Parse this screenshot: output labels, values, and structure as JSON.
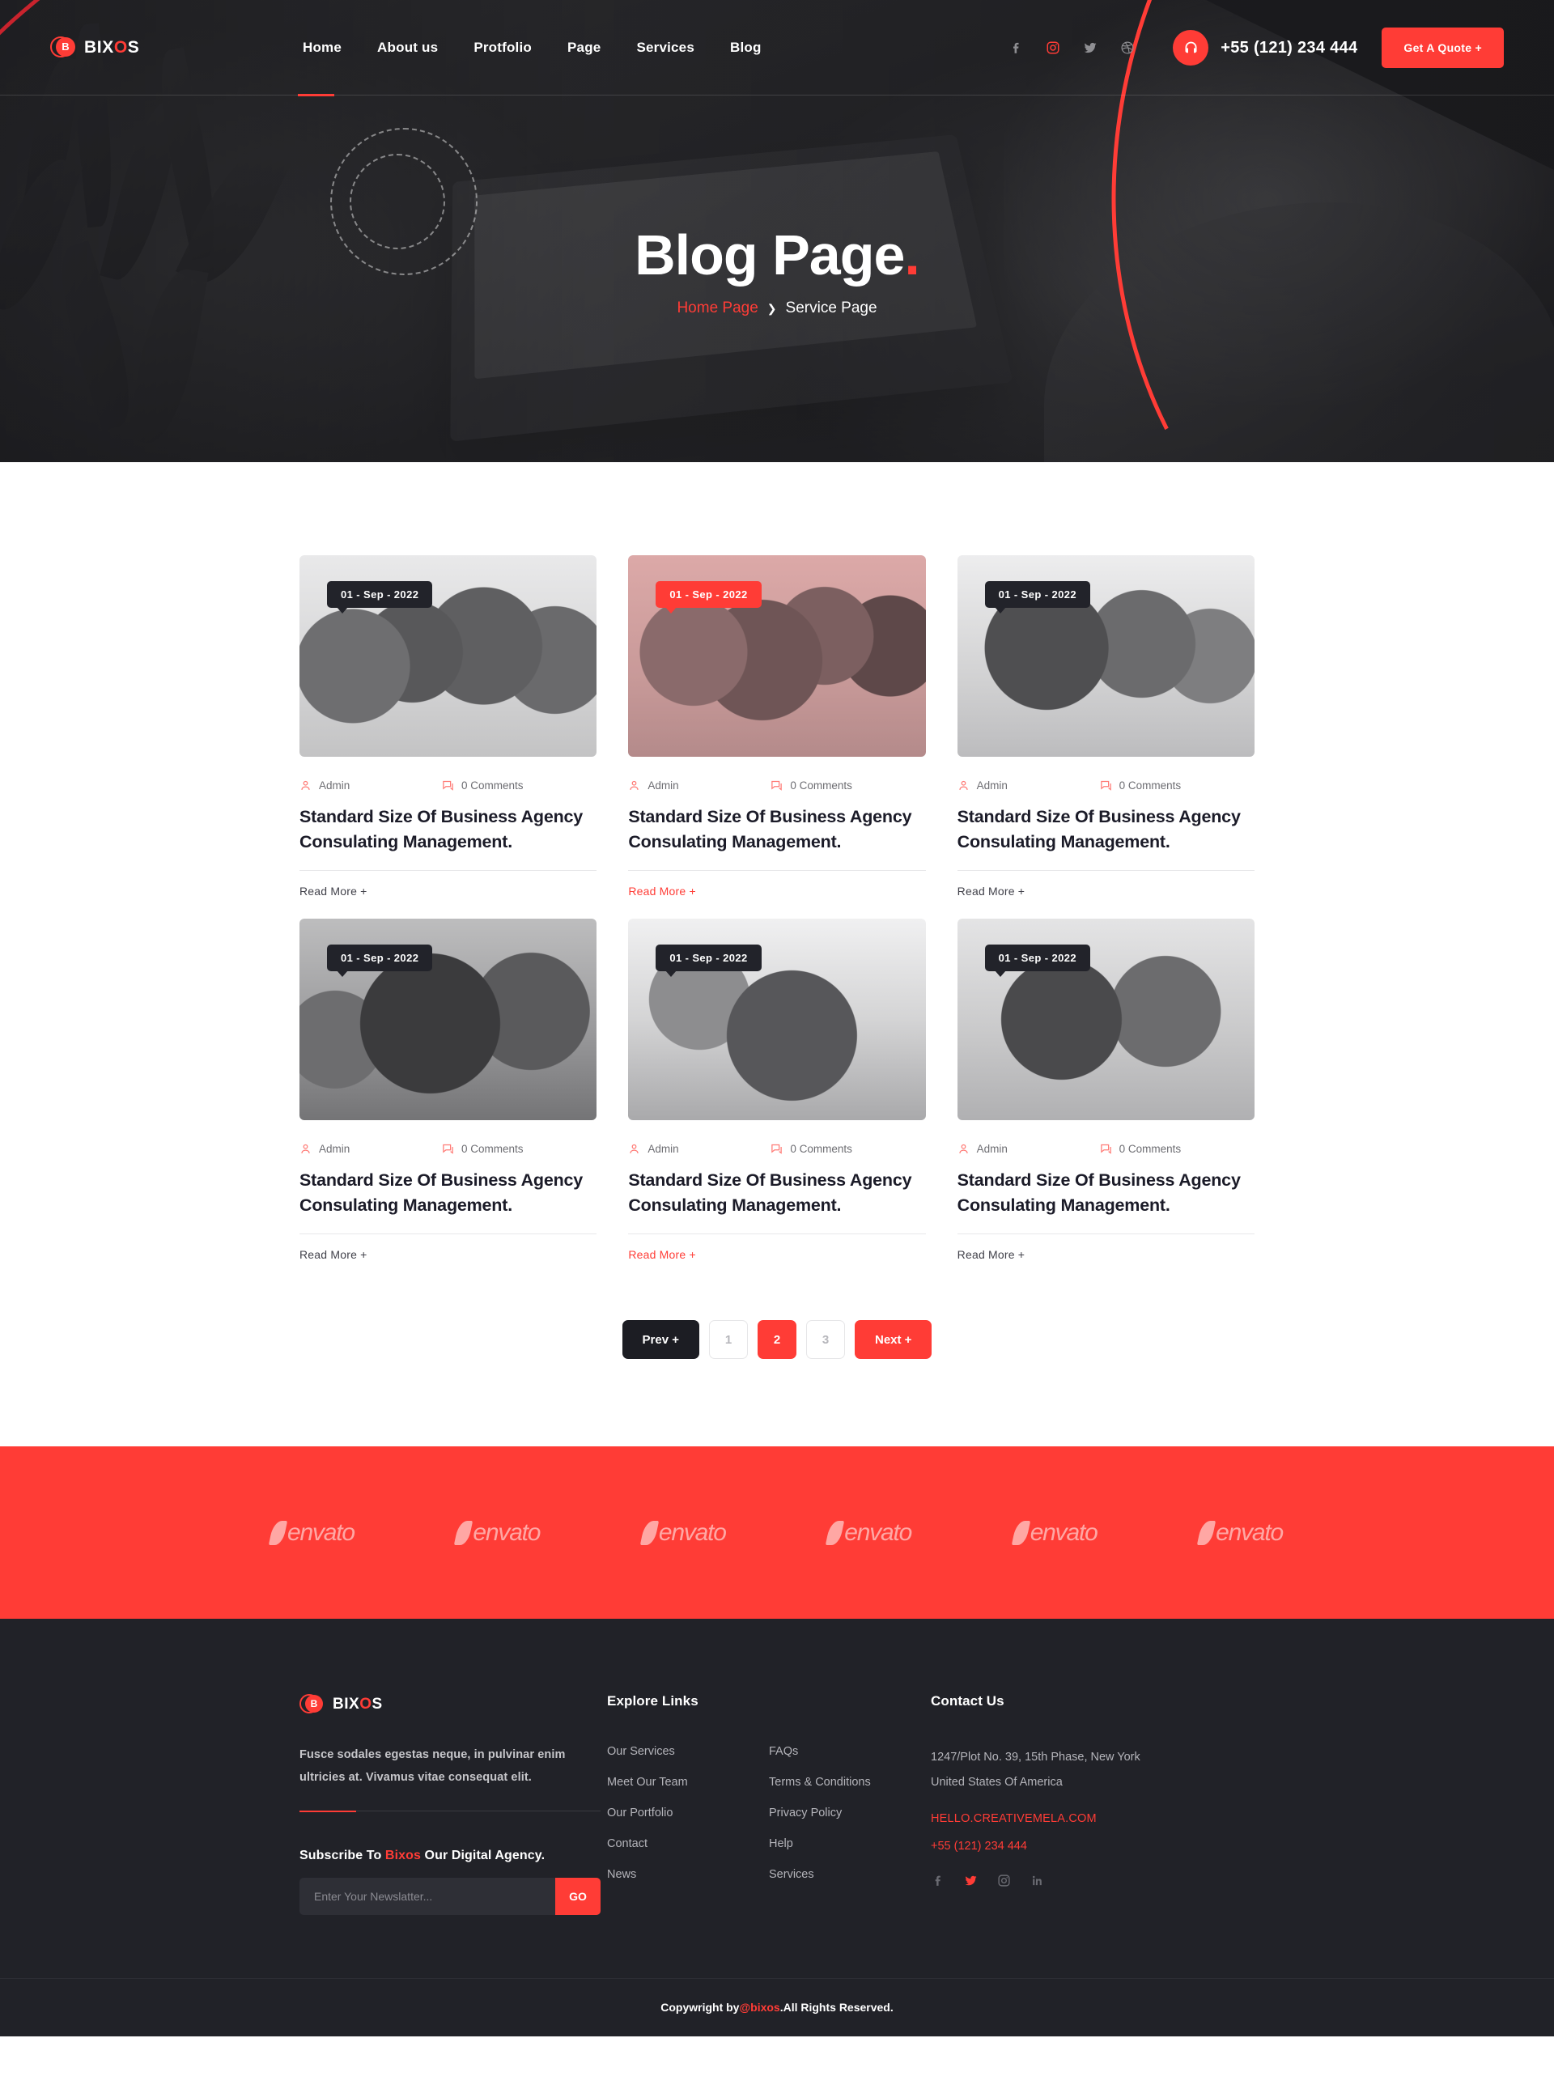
{
  "colors": {
    "accent": "#ff3c36",
    "dark": "#212228",
    "badge_dark": "#22232a",
    "heading": "#1b1b28"
  },
  "header": {
    "logo": {
      "mark_letter": "B",
      "text_pre": "BIX",
      "text_accent": "O",
      "text_post": "S"
    },
    "nav": [
      {
        "label": "Home",
        "active": true
      },
      {
        "label": "About us",
        "active": false
      },
      {
        "label": "Protfolio",
        "active": false
      },
      {
        "label": "Page",
        "active": false
      },
      {
        "label": "Services",
        "active": false
      },
      {
        "label": "Blog",
        "active": false
      }
    ],
    "socials": [
      {
        "name": "facebook-icon",
        "active": false
      },
      {
        "name": "instagram-icon",
        "active": true
      },
      {
        "name": "twitter-icon",
        "active": false
      },
      {
        "name": "dribbble-icon",
        "active": false
      }
    ],
    "phone": "+55 (121) 234 444",
    "quote_button": "Get A Quote +"
  },
  "hero": {
    "title": "Blog Page",
    "title_dot": ".",
    "breadcrumb": {
      "home": "Home Page",
      "separator": "❯",
      "current": "Service Page"
    }
  },
  "blog": {
    "posts": [
      {
        "date": "01 - Sep - 2022",
        "author": "Admin",
        "comments": "0 Comments",
        "title": "Standard Size Of Business Agency Consulating Management.",
        "read_more": "Read More +",
        "highlighted": false,
        "photo": "ph-a"
      },
      {
        "date": "01 - Sep - 2022",
        "author": "Admin",
        "comments": "0 Comments",
        "title": "Standard Size Of Business Agency Consulating Management.",
        "read_more": "Read More +",
        "highlighted": true,
        "photo": "ph-b"
      },
      {
        "date": "01 - Sep - 2022",
        "author": "Admin",
        "comments": "0 Comments",
        "title": "Standard Size Of Business Agency Consulating Management.",
        "read_more": "Read More +",
        "highlighted": false,
        "photo": "ph-c"
      },
      {
        "date": "01 - Sep - 2022",
        "author": "Admin",
        "comments": "0 Comments",
        "title": "Standard Size Of Business Agency Consulating Management.",
        "read_more": "Read More +",
        "highlighted": false,
        "photo": "ph-d"
      },
      {
        "date": "01 - Sep - 2022",
        "author": "Admin",
        "comments": "0 Comments",
        "title": "Standard Size Of Business Agency Consulating Management.",
        "read_more": "Read More +",
        "highlighted": true,
        "photo": "ph-e"
      },
      {
        "date": "01 - Sep - 2022",
        "author": "Admin",
        "comments": "0 Comments",
        "title": "Standard Size Of Business Agency Consulating Management.",
        "read_more": "Read More +",
        "highlighted": false,
        "photo": "ph-f"
      }
    ],
    "pagination": {
      "prev": "Prev +",
      "pages": [
        {
          "label": "1",
          "active": false
        },
        {
          "label": "2",
          "active": true
        },
        {
          "label": "3",
          "active": false
        }
      ],
      "next": "Next +"
    }
  },
  "brands": {
    "items": [
      {
        "name": "envato"
      },
      {
        "name": "envato"
      },
      {
        "name": "envato"
      },
      {
        "name": "envato"
      },
      {
        "name": "envato"
      },
      {
        "name": "envato"
      }
    ]
  },
  "footer": {
    "logo": {
      "mark_letter": "B",
      "text_pre": "BIX",
      "text_accent": "O",
      "text_post": "S"
    },
    "description": "Fusce sodales egestas neque, in pulvinar enim ultricies at. Vivamus vitae consequat elit.",
    "subscribe": {
      "pre": "Subscribe To ",
      "brand": "Bixos",
      "post": " Our Digital Agency."
    },
    "newsletter": {
      "placeholder": "Enter Your Newslatter...",
      "value": "",
      "button": "GO"
    },
    "explore": {
      "heading": "Explore Links",
      "col1": [
        "Our Services",
        "Meet Our Team",
        "Our Portfolio",
        "Contact",
        "News"
      ],
      "col2": [
        "FAQs",
        "Terms & Conditions",
        "Privacy Policy",
        "Help",
        "Services"
      ]
    },
    "contact": {
      "heading": "Contact Us",
      "address_line1": "1247/Plot No. 39, 15th Phase, New York",
      "address_line2": "United States Of America",
      "email": "HELLO.CREATIVEMELA.COM",
      "phone": "+55 (121) 234 444",
      "socials": [
        {
          "name": "facebook-icon",
          "active": false
        },
        {
          "name": "twitter-icon",
          "active": true
        },
        {
          "name": "instagram-icon",
          "active": false
        },
        {
          "name": "linkedin-icon",
          "active": false
        }
      ]
    },
    "copyright": {
      "pre": "Copywright by ",
      "brand": "@bixos",
      "post": ".All Rights Reserved."
    }
  }
}
